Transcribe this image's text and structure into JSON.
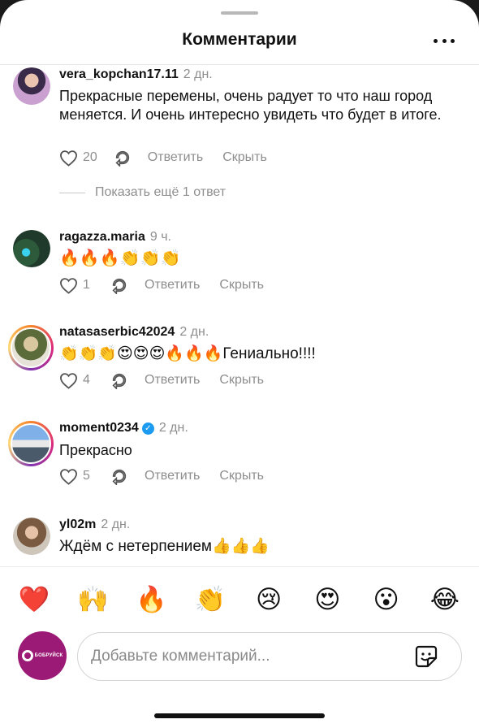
{
  "header": {
    "title": "Комментарии"
  },
  "comments": [
    {
      "username": "vera_kopchan17.11",
      "time": "2 дн.",
      "text": "Прекрасные перемены, очень радует то что наш город меняется. И очень интересно увидеть что будет в итоге.",
      "likes": "20",
      "reply_label": "Ответить",
      "hide_label": "Скрыть",
      "more_replies": "Показать ещё 1 ответ"
    },
    {
      "username": "ragazza.maria",
      "time": "9 ч.",
      "text": "🔥🔥🔥👏👏👏",
      "likes": "1",
      "reply_label": "Ответить",
      "hide_label": "Скрыть"
    },
    {
      "username": "natasaserbic42024",
      "time": "2 дн.",
      "text": "👏👏👏😍😍😍🔥🔥🔥Гениально!!!!",
      "likes": "4",
      "reply_label": "Ответить",
      "hide_label": "Скрыть"
    },
    {
      "username": "moment0234",
      "time": "2 дн.",
      "verified_mark": "✓",
      "text": "Прекрасно",
      "likes": "5",
      "reply_label": "Ответить",
      "hide_label": "Скрыть"
    },
    {
      "username": "yl02m",
      "time": "2 дн.",
      "text": "Ждём с нетерпением👍👍👍"
    }
  ],
  "emoji_bar": [
    "❤️",
    "🙌",
    "🔥",
    "👏",
    "😢",
    "😍",
    "😮",
    "😂"
  ],
  "composer": {
    "avatar_text": "БОБРУЙСК",
    "placeholder": "Добавьте комментарий..."
  },
  "colors": {
    "accent_verified": "#1d9bf0",
    "secondary_text": "#8e8e8e",
    "composer_avatar_bg": "#9b1a75"
  }
}
